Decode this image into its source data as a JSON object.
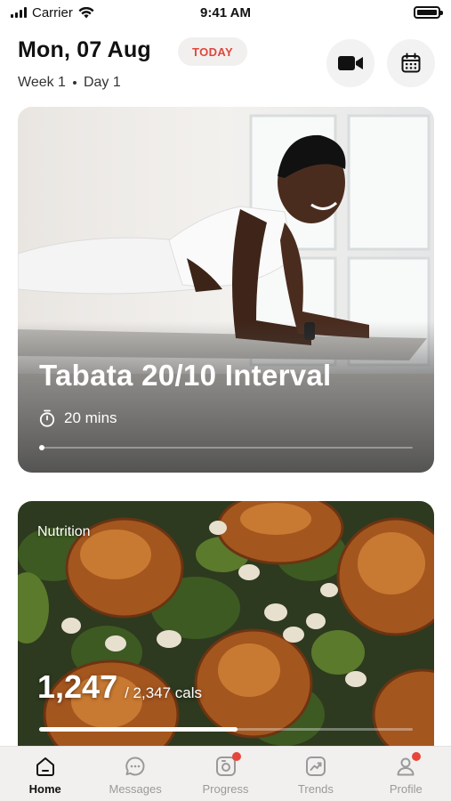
{
  "status_bar": {
    "carrier": "Carrier",
    "time": "9:41 AM"
  },
  "header": {
    "date": "Mon, 07 Aug",
    "badge": "TODAY",
    "week": "Week 1",
    "day": "Day 1",
    "video_icon": "video-camera-icon",
    "calendar_icon": "calendar-icon"
  },
  "workout_card": {
    "title": "Tabata 20/10 Interval",
    "duration": "20 mins",
    "progress_fraction": 0.01
  },
  "nutrition_card": {
    "label": "Nutrition",
    "consumed": "1,247",
    "total": "/ 2,347 cals",
    "progress_fraction": 0.53
  },
  "tabbar": {
    "items": [
      {
        "label": "Home",
        "icon": "home-icon",
        "active": true,
        "badge": false
      },
      {
        "label": "Messages",
        "icon": "chat-icon",
        "active": false,
        "badge": false
      },
      {
        "label": "Progress",
        "icon": "camera-progress-icon",
        "active": false,
        "badge": true
      },
      {
        "label": "Trends",
        "icon": "trend-chart-icon",
        "active": false,
        "badge": false
      },
      {
        "label": "Profile",
        "icon": "person-icon",
        "active": false,
        "badge": true
      }
    ]
  },
  "colors": {
    "accent_red": "#e0463b",
    "badge_bg": "#f2efef"
  }
}
